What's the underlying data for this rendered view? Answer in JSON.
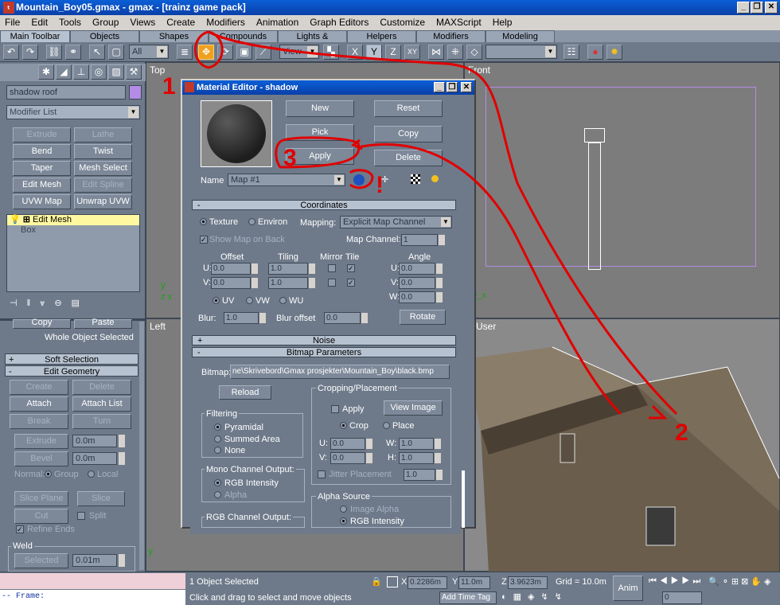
{
  "window": {
    "title": "Mountain_Boy05.gmax - gmax - [trainz game pack]"
  },
  "menu": [
    "File",
    "Edit",
    "Tools",
    "Group",
    "Views",
    "Create",
    "Modifiers",
    "Animation",
    "Graph Editors",
    "Customize",
    "MAXScript",
    "Help"
  ],
  "tabs": [
    "Main Toolbar",
    "Objects",
    "Shapes",
    "Compounds",
    "Lights & Cameras",
    "Helpers",
    "Modifiers",
    "Modeling"
  ],
  "toolbar": {
    "selection_filter": "All",
    "view_dropdown": "View"
  },
  "command_panel": {
    "object_name": "shadow roof",
    "modifier_list": "Modifier List",
    "modifier_buttons": [
      "Extrude",
      "Lathe",
      "Bend",
      "Twist",
      "Taper",
      "Mesh Select",
      "Edit Mesh",
      "Edit Spline",
      "UVW Map",
      "Unwrap UVW"
    ],
    "stack": [
      "Edit Mesh",
      "Box"
    ],
    "copy": "Copy",
    "paste": "Paste",
    "whole_object": "Whole Object Selected",
    "soft_selection": "Soft Selection",
    "edit_geometry": "Edit Geometry",
    "geom_buttons": [
      "Create",
      "Delete",
      "Attach",
      "Attach List",
      "Break",
      "Turn"
    ],
    "extrude": {
      "label": "Extrude",
      "value": "0.0m"
    },
    "bevel": {
      "label": "Bevel",
      "value": "0.0m"
    },
    "normal": "Normal:",
    "group": "Group",
    "local": "Local",
    "slice_plane": "Slice Plane",
    "slice": "Slice",
    "cut": "Cut",
    "split": "Split",
    "refine_ends": "Refine Ends",
    "weld": "Weld",
    "selected": "Selected",
    "weld_value": "0.01m"
  },
  "viewports": {
    "top": "Top",
    "front": "Front",
    "left": "Left",
    "persp": "User"
  },
  "material_editor": {
    "title": "Material Editor - shadow",
    "buttons": {
      "new": "New",
      "reset": "Reset",
      "pick": "Pick",
      "copy": "Copy",
      "apply": "Apply",
      "delete": "Delete"
    },
    "name_label": "Name",
    "name_value": "Map #1",
    "coordinates": "Coordinates",
    "texture": "Texture",
    "environ": "Environ",
    "mapping": "Mapping:",
    "mapping_value": "Explicit Map Channel",
    "show_map": "Show Map on Back",
    "map_channel": "Map Channel:",
    "map_channel_value": "1",
    "offset": "Offset",
    "tiling": "Tiling",
    "mirror": "Mirror",
    "tile": "Tile",
    "angle": "Angle",
    "u": "U:",
    "v": "V:",
    "w": "W:",
    "offset_u": "0.0",
    "offset_v": "0.0",
    "tiling_u": "1.0",
    "tiling_v": "1.0",
    "angle_u": "0.0",
    "angle_v": "0.0",
    "angle_w": "0.0",
    "uv": "UV",
    "vw": "VW",
    "wu": "WU",
    "blur": "Blur:",
    "blur_value": "1.0",
    "blur_offset": "Blur offset",
    "blur_offset_value": "0.0",
    "rotate": "Rotate",
    "noise": "Noise",
    "bitmap_params": "Bitmap Parameters",
    "bitmap": "Bitmap:",
    "bitmap_path": "ne\\Skrivebord\\Gmax prosjekter\\Mountain_Boy\\black.bmp",
    "reload": "Reload",
    "cropping": "Cropping/Placement",
    "apply_crop": "Apply",
    "view_image": "View Image",
    "crop": "Crop",
    "place": "Place",
    "cu": "U:",
    "cu_v": "0.0",
    "cw": "W:",
    "cw_v": "1.0",
    "cv": "V:",
    "cv_v": "0.0",
    "ch": "H:",
    "ch_v": "1.0",
    "jitter": "Jitter Placement",
    "jitter_value": "1.0",
    "filtering": "Filtering",
    "pyramidal": "Pyramidal",
    "summed": "Summed Area",
    "none": "None",
    "mono_out": "Mono Channel Output:",
    "rgb_int": "RGB Intensity",
    "alpha": "Alpha",
    "rgb_out": "RGB Channel Output:",
    "alpha_src": "Alpha Source",
    "image_alpha": "Image Alpha",
    "rgb_int2": "RGB Intensity"
  },
  "status": {
    "selected": "1 Object Selected",
    "prompt": "Click and drag to select and move objects",
    "x": "0.2286m",
    "y": "11.0m",
    "z": "3.9623m",
    "grid": "Grid = 10.0m",
    "anim": "Anim",
    "frame_label": "-- Frame:",
    "time_value": "0",
    "add_time_tag": "Add Time Tag"
  },
  "annotations": [
    "1",
    "2",
    "3",
    "!"
  ]
}
